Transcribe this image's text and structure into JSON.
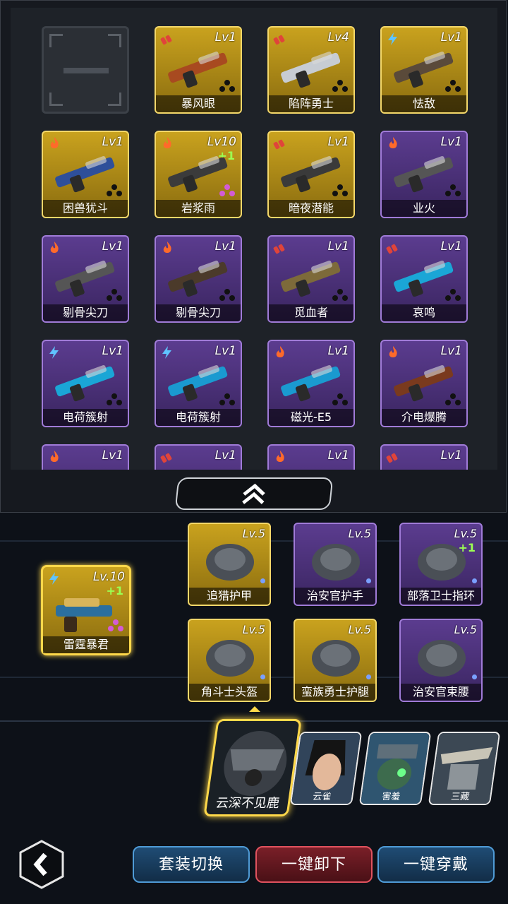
{
  "inventory": {
    "items": [
      {
        "type": "empty"
      },
      {
        "name": "暴风眼",
        "level": "Lv1",
        "rarity": "gold",
        "icon": "bullets-icon"
      },
      {
        "name": "陷阵勇士",
        "level": "Lv4",
        "rarity": "gold",
        "icon": "bullets-icon"
      },
      {
        "name": "怯敌",
        "level": "Lv1",
        "rarity": "gold",
        "icon": "lightning-icon"
      },
      {
        "name": "困兽犹斗",
        "level": "Lv1",
        "rarity": "gold",
        "icon": "fire-icon"
      },
      {
        "name": "岩浆雨",
        "level": "Lv10",
        "rarity": "gold",
        "icon": "fire-icon",
        "plus": "+1"
      },
      {
        "name": "暗夜潜能",
        "level": "Lv1",
        "rarity": "gold",
        "icon": "bullets-icon"
      },
      {
        "name": "业火",
        "level": "Lv1",
        "rarity": "purple",
        "icon": "fire-icon"
      },
      {
        "name": "剔骨尖刀",
        "level": "Lv1",
        "rarity": "purple",
        "icon": "fire-icon"
      },
      {
        "name": "剔骨尖刀",
        "level": "Lv1",
        "rarity": "purple",
        "icon": "fire-icon"
      },
      {
        "name": "觅血者",
        "level": "Lv1",
        "rarity": "purple",
        "icon": "bullets-icon"
      },
      {
        "name": "哀鸣",
        "level": "Lv1",
        "rarity": "purple",
        "icon": "bullets-icon"
      },
      {
        "name": "电荷簇射",
        "level": "Lv1",
        "rarity": "purple",
        "icon": "lightning-icon"
      },
      {
        "name": "电荷簇射",
        "level": "Lv1",
        "rarity": "purple",
        "icon": "lightning-icon"
      },
      {
        "name": "磁光-E5",
        "level": "Lv1",
        "rarity": "purple",
        "icon": "fire-icon"
      },
      {
        "name": "介电爆腾",
        "level": "Lv1",
        "rarity": "purple",
        "icon": "fire-icon"
      },
      {
        "name": "",
        "level": "Lv1",
        "rarity": "purple",
        "icon": "fire-icon"
      },
      {
        "name": "",
        "level": "Lv1",
        "rarity": "purple",
        "icon": "bullets-icon"
      },
      {
        "name": "",
        "level": "Lv1",
        "rarity": "purple",
        "icon": "fire-icon"
      },
      {
        "name": "",
        "level": "Lv1",
        "rarity": "purple",
        "icon": "bullets-icon"
      }
    ]
  },
  "equipped_weapon": {
    "name": "雷霆暴君",
    "level": "Lv.10",
    "plus": "+1",
    "rarity": "gold",
    "icon": "lightning-icon"
  },
  "equipment": [
    {
      "name": "追猎护甲",
      "level": "Lv.5",
      "rarity": "gold"
    },
    {
      "name": "治安官护手",
      "level": "Lv.5",
      "rarity": "purple"
    },
    {
      "name": "部落卫士指环",
      "level": "Lv.5",
      "rarity": "purple",
      "plus": "+1"
    },
    {
      "name": "角斗士头盔",
      "level": "Lv.5",
      "rarity": "gold"
    },
    {
      "name": "蛮族勇士护腿",
      "level": "Lv.5",
      "rarity": "gold"
    },
    {
      "name": "治安官束腰",
      "level": "Lv.5",
      "rarity": "purple"
    }
  ],
  "heroes": [
    {
      "name": "云深不见鹿",
      "selected": true
    },
    {
      "name": "云雀"
    },
    {
      "name": "害羞"
    },
    {
      "name": "三藏"
    }
  ],
  "buttons": {
    "switch_set": "套装切换",
    "unequip_all": "一键卸下",
    "equip_all": "一键穿戴"
  },
  "colors": {
    "gold_rarity": "#c9a21e",
    "purple_rarity": "#5b3c8f",
    "accent_yellow": "#ffd84a",
    "button_blue": "#1f4c74",
    "button_red": "#7a1f28"
  }
}
